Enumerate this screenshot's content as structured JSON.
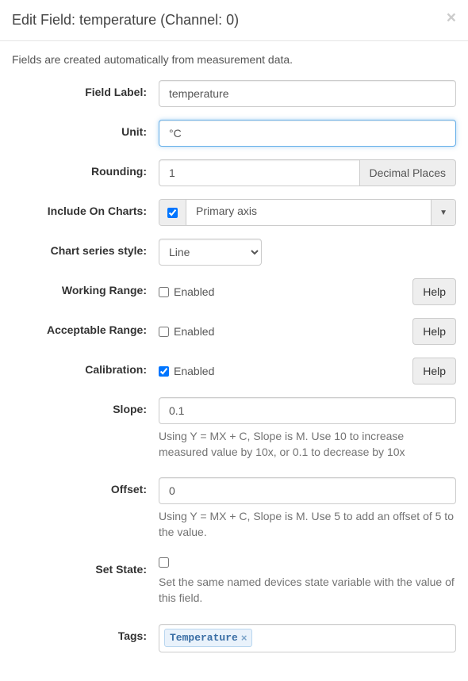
{
  "header": {
    "title": "Edit Field: temperature (Channel: 0)"
  },
  "intro": "Fields are created automatically from measurement data.",
  "form": {
    "fieldLabel": {
      "label": "Field Label:",
      "value": "temperature"
    },
    "unit": {
      "label": "Unit:",
      "value": "°C"
    },
    "rounding": {
      "label": "Rounding:",
      "value": "1",
      "addon": "Decimal Places"
    },
    "includeOnCharts": {
      "label": "Include On Charts:",
      "checked": true,
      "axis": "Primary axis"
    },
    "chartSeriesStyle": {
      "label": "Chart series style:",
      "value": "Line"
    },
    "workingRange": {
      "label": "Working Range:",
      "enabledText": "Enabled",
      "checked": false,
      "help": "Help"
    },
    "acceptableRange": {
      "label": "Acceptable Range:",
      "enabledText": "Enabled",
      "checked": false,
      "help": "Help"
    },
    "calibration": {
      "label": "Calibration:",
      "enabledText": "Enabled",
      "checked": true,
      "help": "Help"
    },
    "slope": {
      "label": "Slope:",
      "value": "0.1",
      "help": "Using Y = MX + C, Slope is M. Use 10 to increase measured value by 10x, or 0.1 to decrease by 10x"
    },
    "offset": {
      "label": "Offset:",
      "value": "0",
      "help": "Using Y = MX + C, Slope is M. Use 5 to add an offset of 5 to the value."
    },
    "setState": {
      "label": "Set State:",
      "checked": false,
      "help": "Set the same named devices state variable with the value of this field."
    },
    "tags": {
      "label": "Tags:",
      "items": [
        "Temperature"
      ]
    }
  }
}
